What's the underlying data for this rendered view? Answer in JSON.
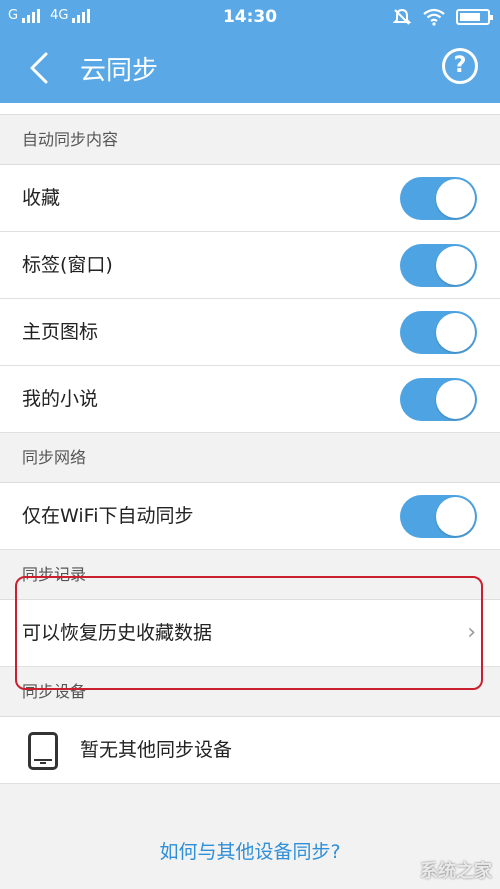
{
  "status_bar": {
    "carrier1": "G",
    "carrier2": "4G",
    "time": "14:30"
  },
  "nav": {
    "title": "云同步",
    "help_symbol": "?"
  },
  "sections": {
    "content": {
      "header": "自动同步内容",
      "items": [
        {
          "label": "收藏",
          "on": true
        },
        {
          "label": "标签(窗口)",
          "on": true
        },
        {
          "label": "主页图标",
          "on": true
        },
        {
          "label": "我的小说",
          "on": true
        }
      ]
    },
    "network": {
      "header": "同步网络",
      "item": {
        "label": "仅在WiFi下自动同步",
        "on": true
      }
    },
    "record": {
      "header": "同步记录",
      "item": {
        "label": "可以恢复历史收藏数据",
        "chevron": "›"
      }
    },
    "devices": {
      "header": "同步设备",
      "item": {
        "label": "暂无其他同步设备",
        "icon": "phone-icon"
      }
    }
  },
  "footer": {
    "link": "如何与其他设备同步?"
  },
  "watermark": "系统之家",
  "colors": {
    "accent": "#5aa9e6",
    "toggle_on": "#4ea4e2",
    "highlight": "#cc1f2e",
    "link": "#2f8fd8"
  }
}
